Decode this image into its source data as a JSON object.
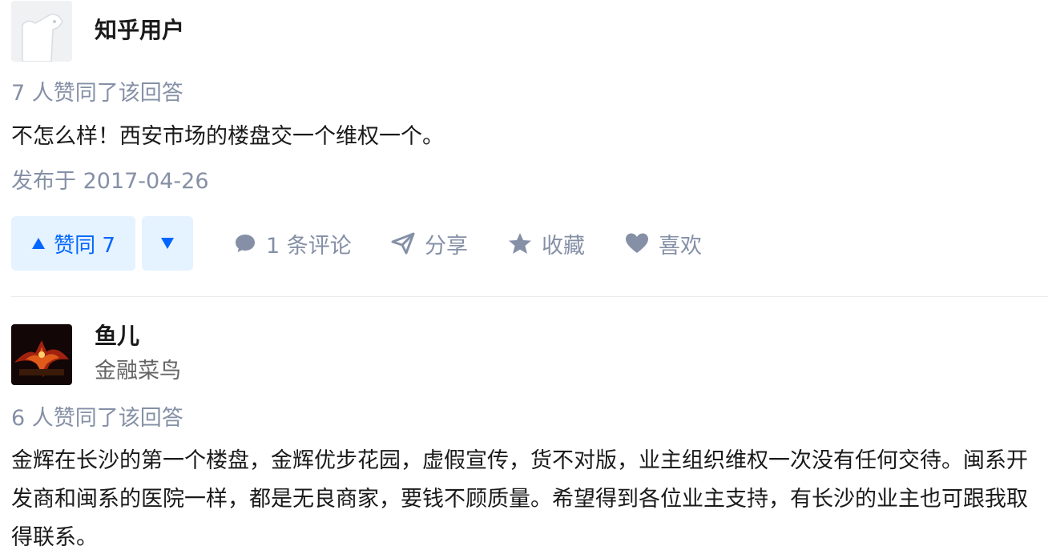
{
  "answers": [
    {
      "author": {
        "name": "知乎用户",
        "headline": ""
      },
      "votes_meta": "7 人赞同了该回答",
      "content": "不怎么样！西安市场的楼盘交一个维权一个。",
      "publish_time": "发布于 2017-04-26",
      "actions": {
        "vote_up_label": "赞同 7",
        "comment_label": "1 条评论",
        "share_label": "分享",
        "collect_label": "收藏",
        "like_label": "喜欢"
      }
    },
    {
      "author": {
        "name": "鱼儿",
        "headline": "金融菜鸟"
      },
      "votes_meta": "6 人赞同了该回答",
      "content": "金辉在长沙的第一个楼盘，金辉优步花园，虚假宣传，货不对版，业主组织维权一次没有任何交待。闽系开发商和闽系的医院一样，都是无良商家，要钱不顾质量。希望得到各位业主支持，有长沙的业主也可跟我取得联系。"
    }
  ],
  "icons": {
    "vote_up": "triangle-up-icon",
    "vote_down": "triangle-down-icon",
    "comment": "comment-bubble-icon",
    "share": "paper-plane-icon",
    "collect": "star-icon",
    "like": "heart-icon"
  },
  "colors": {
    "primary_blue": "#0066ff",
    "vote_bg": "#e5f2ff",
    "meta_gray": "#8590a6",
    "text": "#1a1a1a",
    "divider": "#ebebeb"
  }
}
